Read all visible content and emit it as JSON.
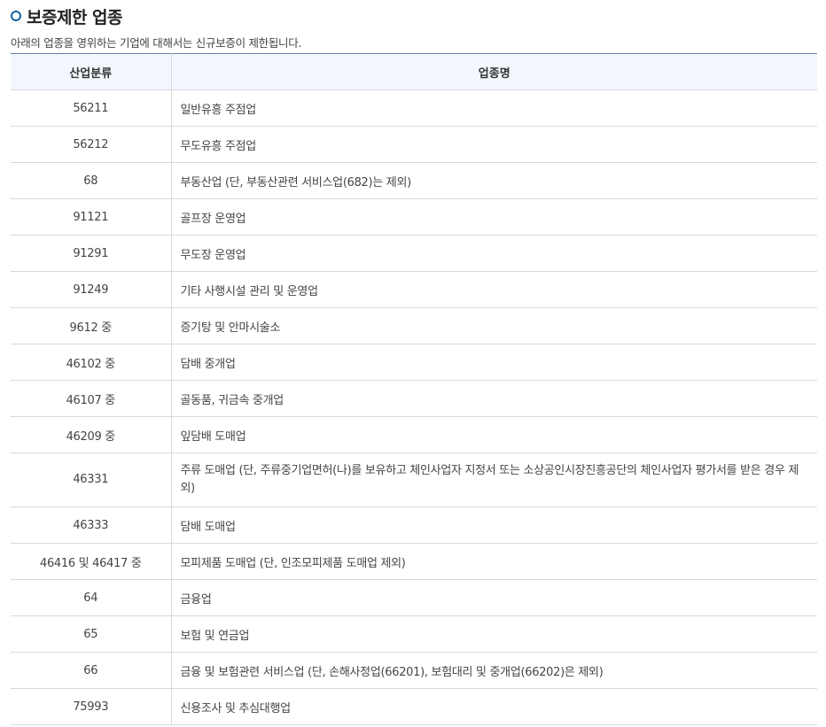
{
  "section": {
    "title": "보증제한 업종",
    "description": "아래의 업종을 영위하는 기업에 대해서는 신규보증이 제한됩니다."
  },
  "table": {
    "headers": {
      "code": "산업분류",
      "name": "업종명"
    },
    "rows": [
      {
        "code": "56211",
        "name": "일반유흥 주점업"
      },
      {
        "code": "56212",
        "name": "무도유흥 주점업"
      },
      {
        "code": "68",
        "name": "부동산업 (단, 부동산관련 서비스업(682)는 제외)"
      },
      {
        "code": "91121",
        "name": "골프장 운영업"
      },
      {
        "code": "91291",
        "name": "무도장 운영업"
      },
      {
        "code": "91249",
        "name": "기타 사행시설 관리 및 운영업"
      },
      {
        "code": "9612 중",
        "name": "증기탕 및 안마시술소"
      },
      {
        "code": "46102 중",
        "name": "담배 중개업"
      },
      {
        "code": "46107 중",
        "name": "골동품, 귀금속 중개업"
      },
      {
        "code": "46209 중",
        "name": "잎담배 도매업"
      },
      {
        "code": "46331",
        "name": "주류 도매업 (단, 주류중기업면허(나)를 보유하고 체인사업자 지정서 또는 소상공인시장진흥공단의 체인사업자 평가서를 받은 경우 제외)"
      },
      {
        "code": "46333",
        "name": "담배 도매업"
      },
      {
        "code": "46416 및 46417 중",
        "name": "모피제품 도매업 (단, 인조모피제품 도매업 제외)"
      },
      {
        "code": "64",
        "name": "금융업"
      },
      {
        "code": "65",
        "name": "보험 및 연금업"
      },
      {
        "code": "66",
        "name": "금융 및 보험관련 서비스업 (단, 손해사정업(66201), 보험대리 및 중개업(66202)은 제외)"
      },
      {
        "code": "75993",
        "name": "신용조사 및 추심대행업"
      }
    ]
  },
  "colors": {
    "accent": "#1a5ea8",
    "header_bg": "#f3f7fd",
    "border": "#d9d9d9"
  }
}
